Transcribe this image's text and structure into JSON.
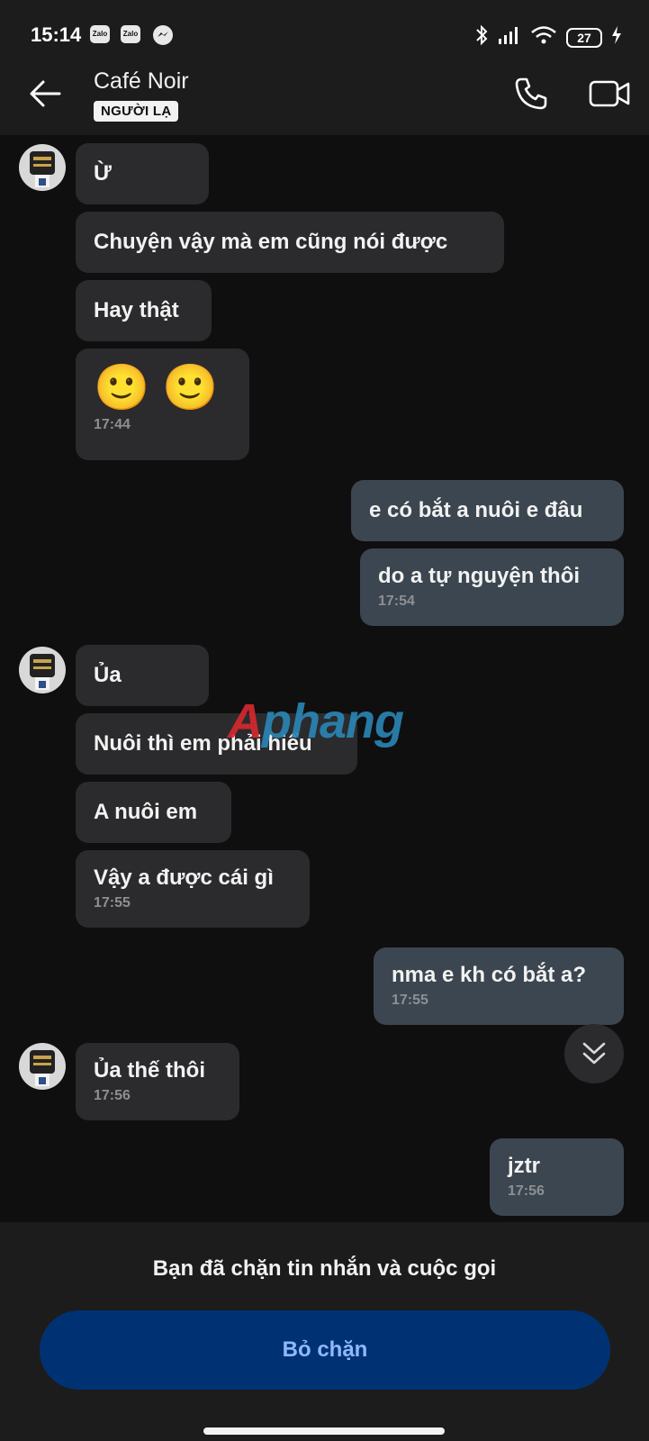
{
  "status_bar": {
    "time": "15:14",
    "app_icons": [
      "Zalo",
      "Zalo"
    ],
    "battery": "27"
  },
  "header": {
    "contact_name": "Café Noir",
    "tag": "NGƯỜI LẠ"
  },
  "messages": [
    {
      "dir": "in",
      "text": "Ừ"
    },
    {
      "dir": "in",
      "text": "Chuyện vậy mà em cũng nói được"
    },
    {
      "dir": "in",
      "text": "Hay thật"
    },
    {
      "dir": "in",
      "text": "🙂 🙂",
      "time": "17:44"
    },
    {
      "dir": "out",
      "text": "e có bắt a nuôi e đâu"
    },
    {
      "dir": "out",
      "text": "do a tự nguyện thôi",
      "time": "17:54"
    },
    {
      "dir": "in",
      "text": "Ủa"
    },
    {
      "dir": "in",
      "text": "Nuôi thì em phải hiểu"
    },
    {
      "dir": "in",
      "text": "A nuôi em"
    },
    {
      "dir": "in",
      "text": "Vậy a được cái gì",
      "time": "17:55"
    },
    {
      "dir": "out",
      "text": "nma e kh có bắt a?",
      "time": "17:55"
    },
    {
      "dir": "in",
      "text": "Ủa thế thôi",
      "time": "17:56"
    },
    {
      "dir": "out",
      "text": "jztr",
      "time": "17:56"
    }
  ],
  "watermark": {
    "part1": "A",
    "part2": "phang"
  },
  "bottom": {
    "blocked_text": "Bạn đã chặn tin nhắn và cuộc gọi",
    "unblock_label": "Bỏ chặn"
  }
}
